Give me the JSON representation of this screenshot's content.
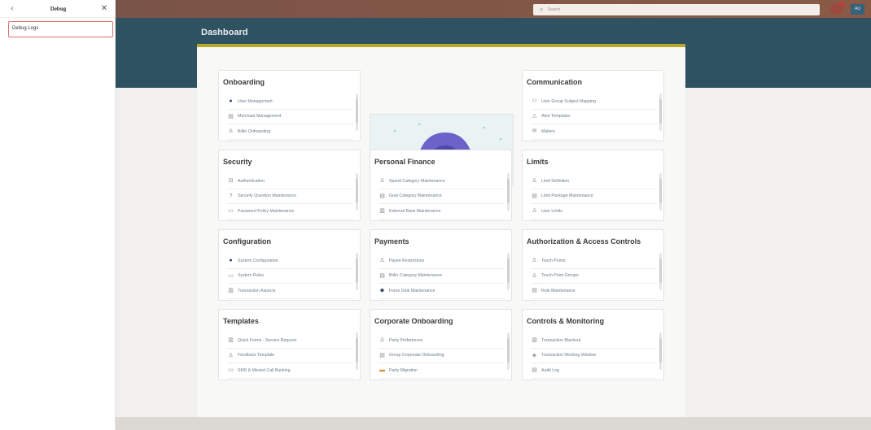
{
  "debug": {
    "back_icon": "chevron-left-icon",
    "title": "Debug",
    "close_icon": "close-icon",
    "logs_label": "Debug Logs"
  },
  "topbar": {
    "search_icon": "search-icon",
    "search_placeholder": "Search",
    "notification_icon": "bell-icon",
    "avatar_initials": "AU"
  },
  "page": {
    "title": "Dashboard"
  },
  "colors": {
    "topbar": "#7a5348",
    "header_band": "#2e5261",
    "accent_strip": "#b7a72a",
    "card_link": "#6a7c8c"
  },
  "cards": [
    {
      "title": "Onboarding",
      "items": [
        {
          "label": "User Management",
          "icon": "circle-icon"
        },
        {
          "label": "Merchant Management",
          "icon": "merchant-icon"
        },
        {
          "label": "Biller Onboarding",
          "icon": "biller-icon"
        }
      ]
    },
    {
      "title": "Communication",
      "items": [
        {
          "label": "User Group Subject Mapping",
          "icon": "group-icon"
        },
        {
          "label": "Alert Templates",
          "icon": "alert-icon"
        },
        {
          "label": "Mailers",
          "icon": "mail-icon"
        }
      ]
    },
    {
      "title": "Security",
      "items": [
        {
          "label": "Authentication",
          "icon": "lock-icon"
        },
        {
          "label": "Security Question Maintenance",
          "icon": "question-icon"
        },
        {
          "label": "Password Policy Maintenance",
          "icon": "password-icon"
        }
      ]
    },
    {
      "title": "Personal Finance",
      "items": [
        {
          "label": "Spend Category Maintenance",
          "icon": "spend-icon"
        },
        {
          "label": "Goal Category Maintenance",
          "icon": "goal-icon"
        },
        {
          "label": "External Bank Maintenance",
          "icon": "bank-icon"
        }
      ]
    },
    {
      "title": "Limits",
      "items": [
        {
          "label": "Limit Definition",
          "icon": "limit-icon"
        },
        {
          "label": "Limit Package Maintenance",
          "icon": "package-icon"
        },
        {
          "label": "User Limits",
          "icon": "user-icon"
        }
      ]
    },
    {
      "title": "Configuration",
      "items": [
        {
          "label": "System Configuration",
          "icon": "circle-icon"
        },
        {
          "label": "System Rules",
          "icon": "rules-icon"
        },
        {
          "label": "Transaction Aspects",
          "icon": "transaction-icon"
        }
      ]
    },
    {
      "title": "Payments",
      "items": [
        {
          "label": "Payee Restrictions",
          "icon": "payee-icon"
        },
        {
          "label": "Biller Category Maintenance",
          "icon": "biller-category-icon"
        },
        {
          "label": "Forex Deal Maintenance",
          "icon": "forex-icon"
        }
      ]
    },
    {
      "title": "Authorization & Access Controls",
      "items": [
        {
          "label": "Touch Points",
          "icon": "touch-icon"
        },
        {
          "label": "Touch Point Groups",
          "icon": "touch-group-icon"
        },
        {
          "label": "Role Maintenance",
          "icon": "role-icon"
        }
      ]
    },
    {
      "title": "Templates",
      "items": [
        {
          "label": "Quick Forms - Service Request",
          "icon": "form-icon"
        },
        {
          "label": "Feedback Template",
          "icon": "feedback-icon"
        },
        {
          "label": "SMS & Missed Call Banking",
          "icon": "sms-icon"
        }
      ]
    },
    {
      "title": "Corporate Onboarding",
      "items": [
        {
          "label": "Party Preferences",
          "icon": "party-icon"
        },
        {
          "label": "Group Corporate Onboarding",
          "icon": "corporate-icon"
        },
        {
          "label": "Party Migration",
          "icon": "migration-icon"
        }
      ]
    },
    {
      "title": "Controls & Monitoring",
      "items": [
        {
          "label": "Transaction Blackout",
          "icon": "blackout-icon"
        },
        {
          "label": "Transaction Working Window",
          "icon": "window-icon"
        },
        {
          "label": "Audit Log",
          "icon": "audit-icon"
        }
      ]
    }
  ]
}
